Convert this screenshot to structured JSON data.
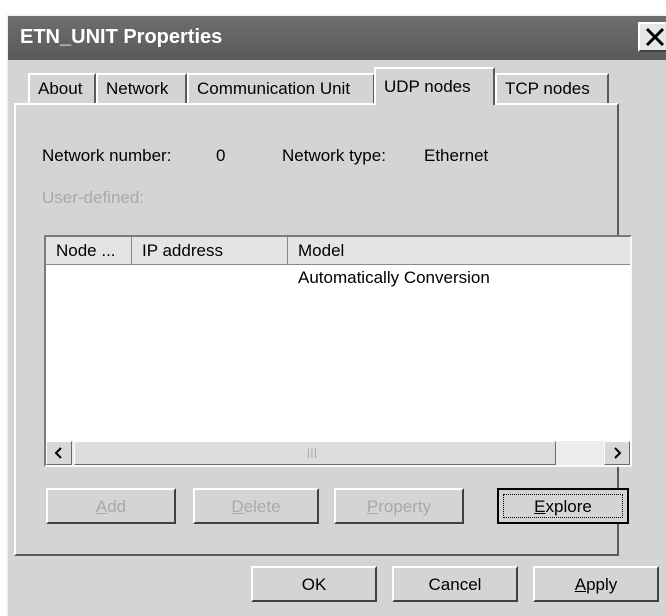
{
  "window": {
    "title": "ETN_UNIT Properties"
  },
  "tabs": [
    {
      "label": "About",
      "active": false
    },
    {
      "label": "Network",
      "active": false
    },
    {
      "label": "Communication Unit",
      "active": false
    },
    {
      "label": "UDP nodes",
      "active": true
    },
    {
      "label": "TCP nodes",
      "active": false
    }
  ],
  "info": {
    "network_number_label": "Network number:",
    "network_number_value": "0",
    "network_type_label": "Network type:",
    "network_type_value": "Ethernet",
    "user_defined_label": "User-defined:"
  },
  "list": {
    "columns": [
      "Node ...",
      "IP address",
      "Model"
    ],
    "rows": [
      {
        "node": "",
        "ip": "",
        "model": "Automatically Conversion"
      }
    ]
  },
  "list_buttons": {
    "add": "Add",
    "add_key": "A",
    "add_rest": "dd",
    "delete": "Delete",
    "delete_key": "D",
    "delete_rest": "elete",
    "property": "Property",
    "property_key": "P",
    "property_rest": "roperty",
    "explore": "Explore",
    "explore_key": "E",
    "explore_rest": "xplore"
  },
  "dialog_buttons": {
    "ok": "OK",
    "cancel": "Cancel",
    "apply": "Apply",
    "apply_key": "A",
    "apply_rest": "pply"
  },
  "colors": {
    "titlebar": "#5e5e5e",
    "face": "#d4d4d4",
    "disabled_text": "#a9a9a9"
  }
}
